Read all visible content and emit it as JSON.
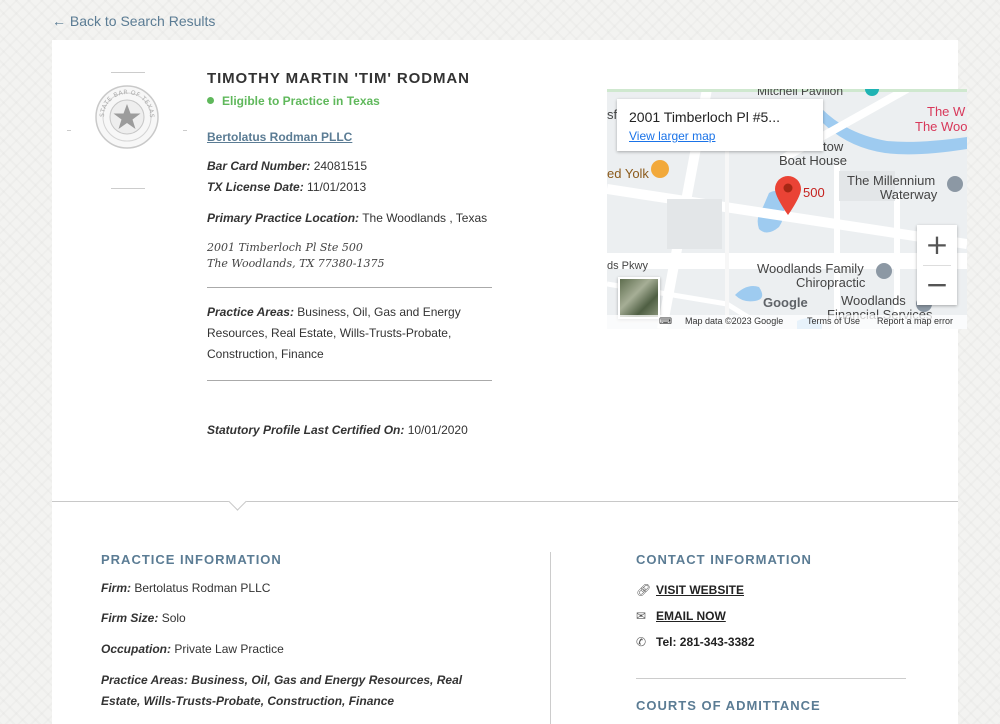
{
  "nav": {
    "back": "← Back to Search Results"
  },
  "profile": {
    "seal_text": "STATE BAR OF TEXAS",
    "name": "TIMOTHY MARTIN 'TIM' RODMAN",
    "status": "Eligible to Practice in Texas",
    "firm": "Bertolatus Rodman PLLC",
    "bar_card_label": "Bar Card Number:",
    "bar_card": "24081515",
    "license_label": "TX License Date:",
    "license_date": "11/01/2013",
    "location_label": "Primary Practice Location:",
    "location": "The Woodlands , Texas",
    "address_line1": "2001 Timberloch Pl Ste 500",
    "address_line2": "The Woodlands, TX 77380-1375",
    "areas_label": "Practice Areas:",
    "areas": "Business, Oil, Gas and Energy Resources, Real Estate, Wills-Trusts-Probate, Construction, Finance",
    "certified_label": "Statutory Profile Last Certified On:",
    "certified": "10/01/2020"
  },
  "map": {
    "info_title": "2001 Timberloch Pl #5...",
    "larger_map": "View larger map",
    "pin_label": "500",
    "labels": [
      "Mitchell Pavilion",
      "The W",
      "The Woo",
      "Boat House",
      "The Millennium",
      "Waterway",
      "ed Yolk",
      "ds Pkwy",
      "Woodlands Family",
      "Chiropractic",
      "Woodlands",
      "Financial Services",
      "tow",
      "sf"
    ],
    "google": "Google",
    "footer_data": "Map data ©2023 Google",
    "footer_terms": "Terms of Use",
    "footer_report": "Report a map error",
    "zoom_in": "+",
    "zoom_out": "−"
  },
  "practice_info": {
    "title": "PRACTICE INFORMATION",
    "firm_label": "Firm:",
    "firm": "Bertolatus Rodman PLLC",
    "size_label": "Firm Size:",
    "size": "Solo",
    "occupation_label": "Occupation:",
    "occupation": "Private Law Practice",
    "areas_label": "Practice Areas:",
    "areas": "Business, Oil, Gas and Energy Resources, Real Estate, Wills-Trusts-Probate, Construction, Finance"
  },
  "contact": {
    "title": "CONTACT INFORMATION",
    "website": "VISIT WEBSITE",
    "email": "EMAIL NOW",
    "tel": "Tel: 281-343-3382"
  },
  "courts": {
    "title": "COURTS OF ADMITTANCE"
  },
  "colors": {
    "accent": "#5b7c94",
    "eligible": "#5fb85b",
    "link": "#1a73e8",
    "pin": "#ea4335"
  }
}
